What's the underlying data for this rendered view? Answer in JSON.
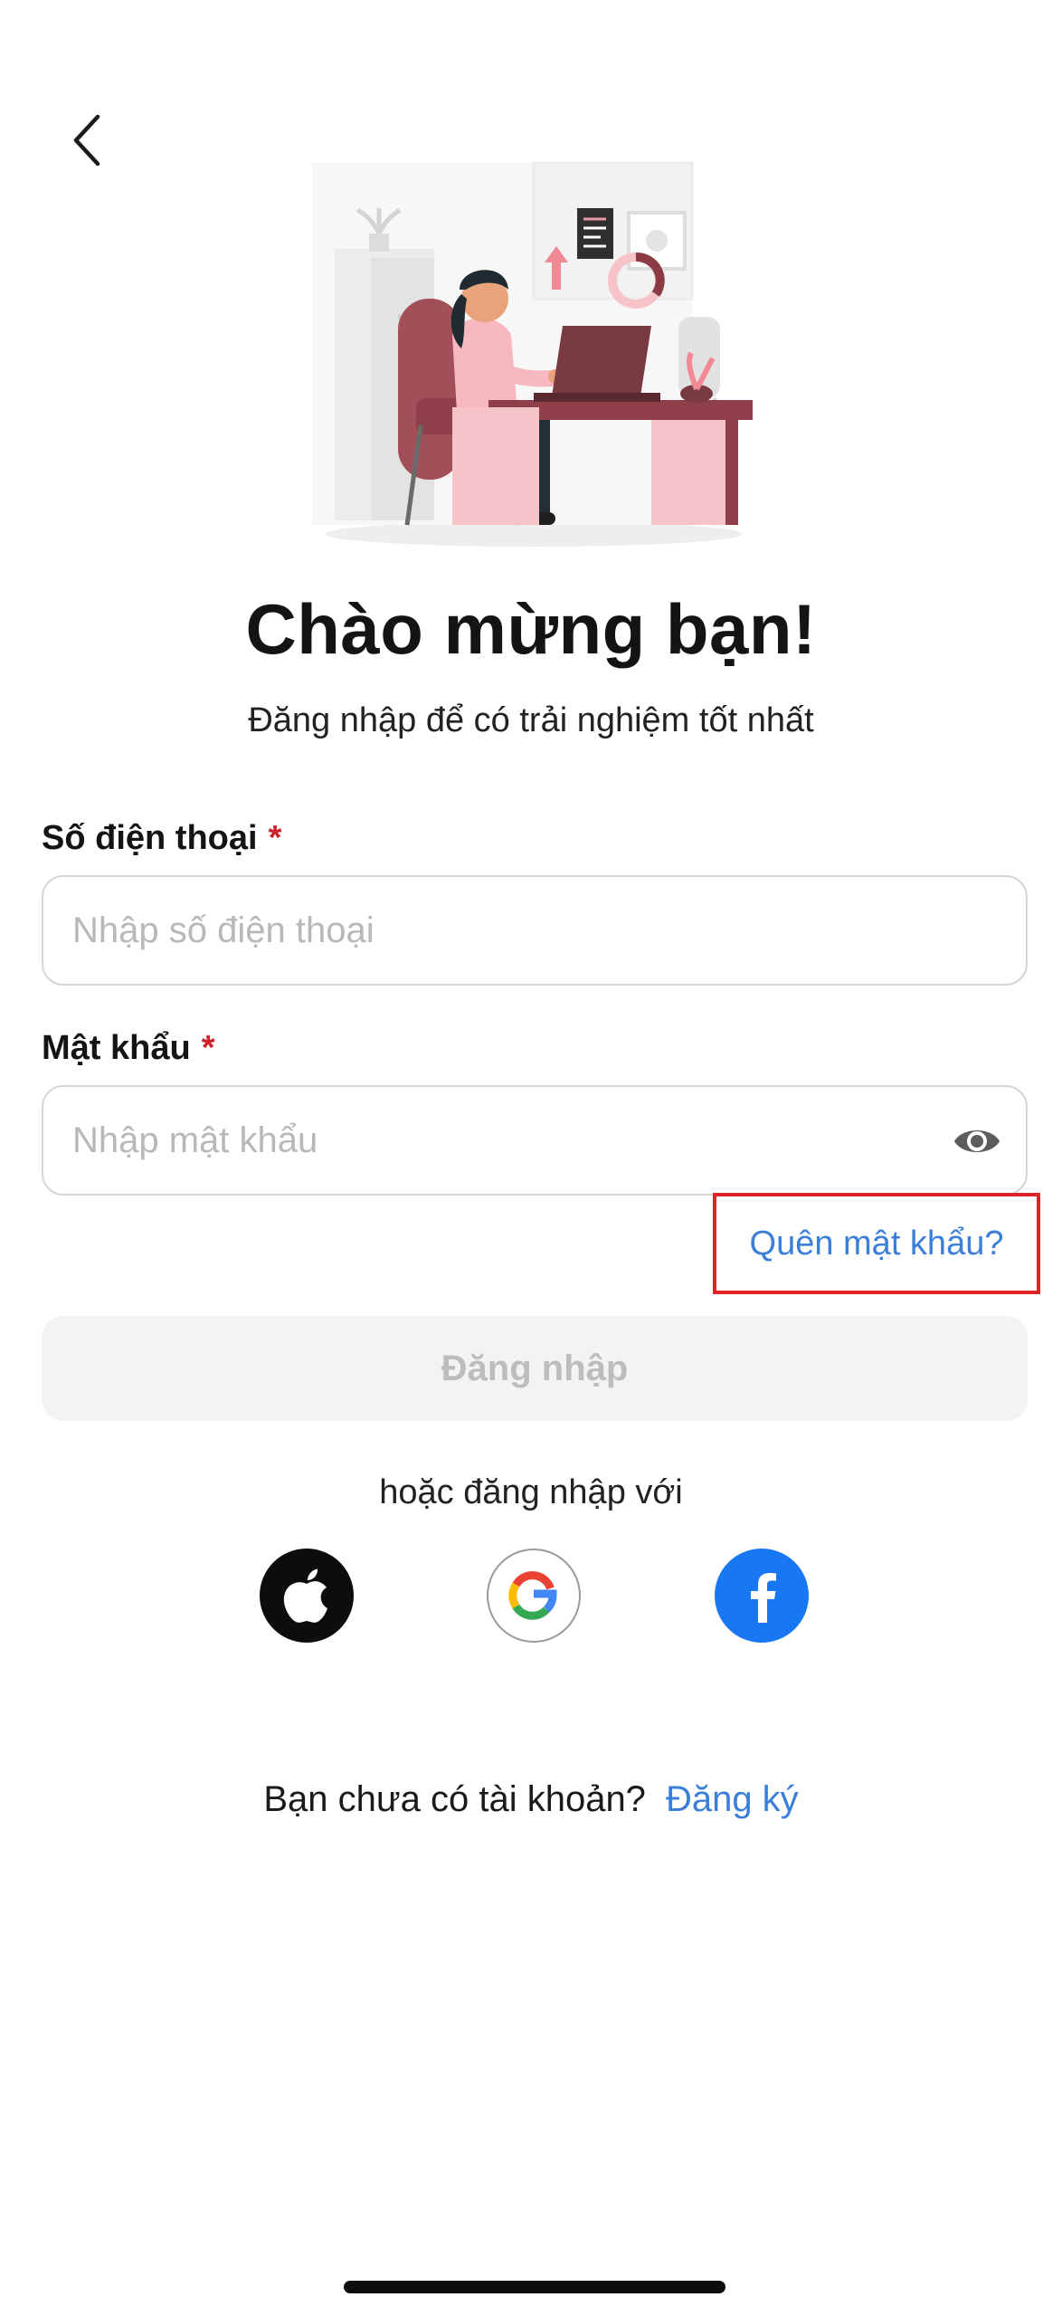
{
  "header": {
    "back_icon": "chevron-left-icon"
  },
  "hero": {
    "illustration": "woman-working-at-laptop-illustration"
  },
  "welcome": {
    "title": "Chào mừng bạn!",
    "subtitle": "Đăng nhập để có trải nghiệm tốt nhất"
  },
  "form": {
    "phone": {
      "label": "Số điện thoại",
      "required_mark": "*",
      "placeholder": "Nhập số điện thoại",
      "value": ""
    },
    "password": {
      "label": "Mật khẩu",
      "required_mark": "*",
      "placeholder": "Nhập mật khẩu",
      "value": "",
      "toggle_icon": "eye-icon"
    },
    "forgot_password": "Quên mật khẩu?",
    "login_button": "Đăng nhập"
  },
  "social": {
    "prompt": "hoặc đăng nhập với",
    "providers": [
      {
        "name": "Apple",
        "icon": "apple-icon",
        "color": "#0d0d0d"
      },
      {
        "name": "Google",
        "icon": "google-icon",
        "color": "#ffffff"
      },
      {
        "name": "Facebook",
        "icon": "facebook-icon",
        "color": "#1877f2"
      }
    ]
  },
  "signup": {
    "prompt": "Bạn chưa có tài khoản?",
    "link": "Đăng ký"
  },
  "colors": {
    "accent": "#3b7fd9",
    "required": "#d0202a",
    "highlight_box": "#e0222b",
    "disabled_button_bg": "#f3f3f3",
    "disabled_button_text": "#bdbdbd"
  }
}
